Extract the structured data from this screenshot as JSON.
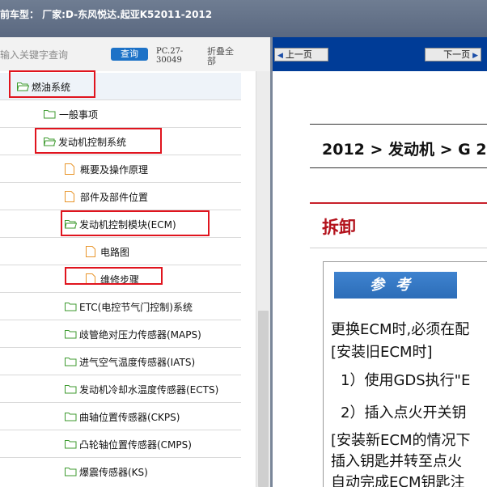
{
  "window": {
    "title": "前车型：  厂家:D-东风悦达.起亚K52011-2012"
  },
  "toolbar": {
    "search_placeholder": "输入关键字查询",
    "search_button": "查询",
    "pc_code": "PC.27-30049",
    "fold_all": "折叠全部"
  },
  "tree": {
    "items": [
      {
        "label": "燃油系统",
        "icon": "folder-open-icon"
      },
      {
        "label": "一般事项",
        "icon": "folder-icon"
      },
      {
        "label": "发动机控制系统",
        "icon": "folder-open-icon"
      },
      {
        "label": "概要及操作原理",
        "icon": "page-icon"
      },
      {
        "label": "部件及部件位置",
        "icon": "page-icon"
      },
      {
        "label": "发动机控制模块(ECM)",
        "icon": "folder-open-icon"
      },
      {
        "label": "电路图",
        "icon": "page-icon"
      },
      {
        "label": "维修步骤",
        "icon": "page-icon"
      },
      {
        "label": "ETC(电控节气门控制)系统",
        "icon": "folder-icon"
      },
      {
        "label": "歧管绝对压力传感器(MAPS)",
        "icon": "folder-icon"
      },
      {
        "label": "进气空气温度传感器(IATS)",
        "icon": "folder-icon"
      },
      {
        "label": "发动机冷却水温度传感器(ECTS)",
        "icon": "folder-icon"
      },
      {
        "label": "曲轴位置传感器(CKPS)",
        "icon": "folder-icon"
      },
      {
        "label": "凸轮轴位置传感器(CMPS)",
        "icon": "folder-icon"
      },
      {
        "label": "爆震传感器(KS)",
        "icon": "folder-icon"
      }
    ]
  },
  "nav": {
    "prev_page": "上一页",
    "next_page": "下一页"
  },
  "document": {
    "breadcrumb_title": "2012 > 发动机 > G 2",
    "section_title": "拆卸",
    "note_label": "参考",
    "lines": [
      "更换ECM时,必须在配",
      "[安装旧ECM时]",
      "1）使用GDS执行\"E",
      "2）插入点火开关钥",
      "[安装新ECM的情况下",
      "插入钥匙并转至点火",
      "自动完成ECM钥匙注"
    ]
  },
  "colors": {
    "title_bar": "#5a6880",
    "nav_bar": "#003c97",
    "search_button": "#1d72c7",
    "highlight": "#e0141e",
    "section_red": "#b3121c",
    "folder_green": "#3c9a2e",
    "page_orange": "#e8952a"
  }
}
